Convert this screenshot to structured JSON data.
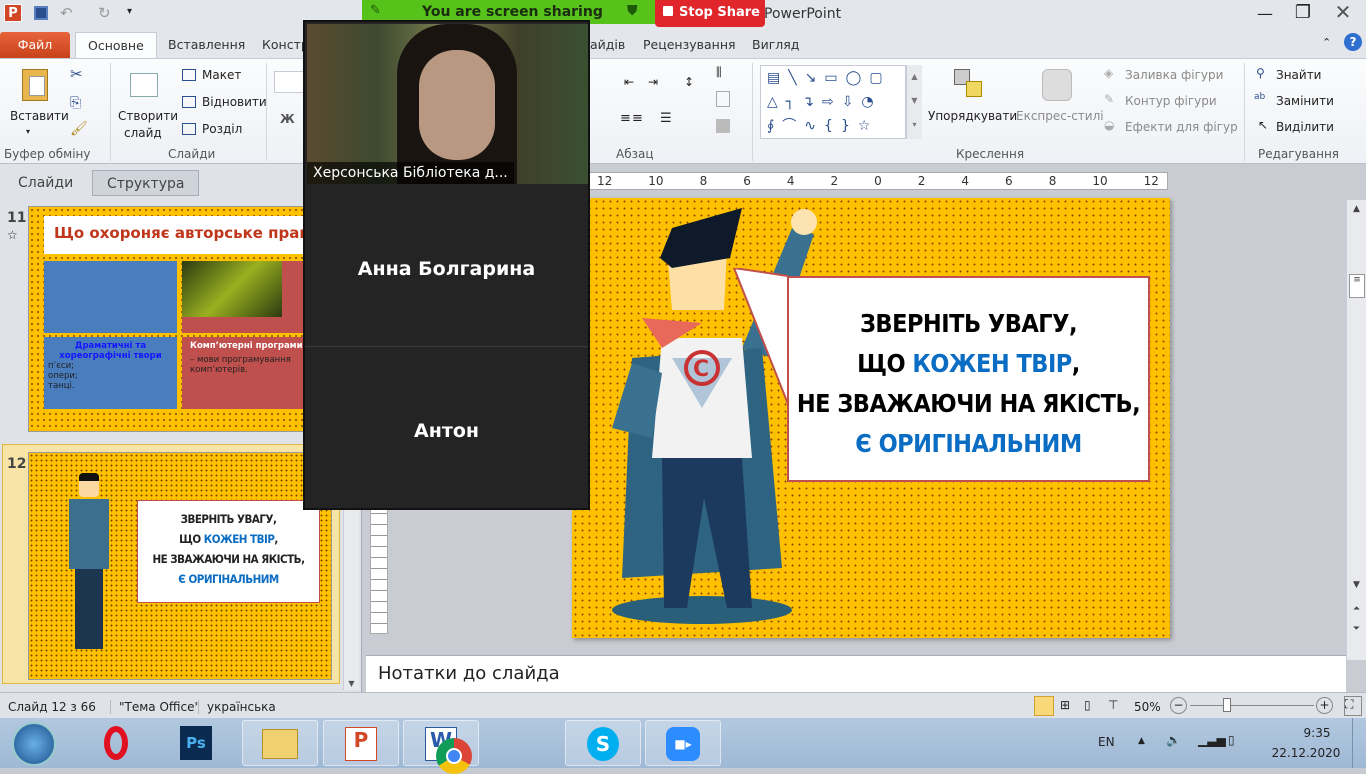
{
  "app": {
    "title": "PowerPoint"
  },
  "share": {
    "banner": "You are screen sharing",
    "stop": "Stop Share",
    "banner_color": "#56c21a",
    "stop_color": "#e0262b"
  },
  "tabs": [
    {
      "label": "Файл"
    },
    {
      "label": "Основне"
    },
    {
      "label": "Вставлення"
    },
    {
      "label": "Констр"
    },
    {
      "label": "айдів"
    },
    {
      "label": "Рецензування"
    },
    {
      "label": "Вигляд"
    }
  ],
  "ribbon": {
    "clipboard": {
      "paste": "Вставити",
      "label": "Буфер обміну"
    },
    "slides": {
      "new_slide_1": "Створити",
      "new_slide_2": "слайд",
      "layout": "Макет",
      "reset": "Відновити",
      "section": "Розділ",
      "label": "Слайди"
    },
    "font": {
      "bold": "Ж"
    },
    "paragraph": {
      "label": "Абзац"
    },
    "drawing": {
      "arrange": "Упорядкувати",
      "quick_styles": "Експрес-стилі",
      "fill": "Заливка фігури",
      "outline": "Контур фігури",
      "effects": "Ефекти для фігур",
      "label": "Креслення"
    },
    "editing": {
      "find": "Знайти",
      "replace": "Замінити",
      "select": "Виділити",
      "label": "Редагування"
    }
  },
  "leftpane": {
    "tabs": [
      "Слайди",
      "Структура"
    ],
    "slide11": {
      "number": "11",
      "title": "Що охороняє авторське право?",
      "box1_title": "Драматичні та хореографічні твори",
      "box1_items": [
        "п’єси;",
        "опери;",
        "танці."
      ],
      "box2_title": "Комп’ютерні програми",
      "box2_text": "– мови програмування комп’ютерів."
    },
    "slide12": {
      "number": "12"
    }
  },
  "slide": {
    "line1": "Зверніть увагу,",
    "line2a": "що ",
    "line2b": "кожен твір",
    ",": ",",
    "line3": "не зважаючи на якість,",
    "line4a": "є ",
    "line4b": "оригінальним"
  },
  "ruler": {
    "ticks": [
      "12",
      "10",
      "8",
      "6",
      "4",
      "2",
      "0",
      "2",
      "4",
      "6",
      "8",
      "10",
      "12"
    ]
  },
  "notes": {
    "placeholder": "Нотатки до слайда"
  },
  "zoom": {
    "video_name": "Херсонська Бібліотека д...",
    "participant1": "Анна Болгарина",
    "participant2": "Антон"
  },
  "status": {
    "slide": "Слайд 12 з 66",
    "theme": "\"Тема Office\"",
    "language": "українська",
    "zoom": "50%",
    "zoom_fraction": 0.3
  },
  "taskbar": {
    "apps": [
      "start",
      "opera",
      "photoshop",
      "explorer",
      "powerpoint",
      "word",
      "chrome",
      "skype",
      "zoom"
    ],
    "lang": "EN",
    "time": "9:35",
    "date": "22.12.2020"
  }
}
